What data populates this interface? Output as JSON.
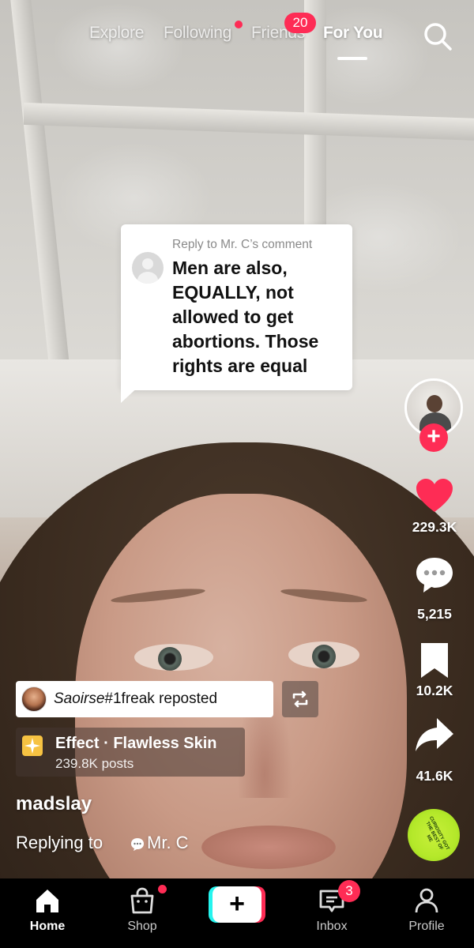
{
  "top_nav": {
    "tabs": [
      {
        "label": "Explore"
      },
      {
        "label": "Following"
      },
      {
        "label": "Friends"
      },
      {
        "label": "For You"
      }
    ],
    "friends_badge": "20",
    "active_tab": "For You"
  },
  "reply_sticker": {
    "reply_to": "Reply to Mr. C’s comment",
    "text": "Men are also, EQUALLY, not allowed to get abortions. Those rights are equal"
  },
  "rail": {
    "likes": "229.3K",
    "comments": "5,215",
    "saves": "10.2K",
    "shares": "41.6K",
    "follow_plus": "+",
    "music_disc_text": "CURIOSITY GOT THE BEST OF ME"
  },
  "overlay": {
    "repost_name": "Saoirse",
    "repost_rest": "#1freak reposted",
    "effect_title": "Effect · Flawless Skin",
    "effect_posts": "239.8K posts",
    "username": "madslay",
    "replying_prefix": "Replying to",
    "replying_user": "Mr. C"
  },
  "bottom_bar": {
    "tabs": [
      {
        "label": "Home",
        "icon": "home-icon"
      },
      {
        "label": "Shop",
        "icon": "shop-bag-icon"
      },
      {
        "label": "",
        "icon": "create-plus-icon"
      },
      {
        "label": "Inbox",
        "icon": "inbox-icon"
      },
      {
        "label": "Profile",
        "icon": "profile-icon"
      }
    ],
    "inbox_badge": "3",
    "create_symbol": "+"
  },
  "colors": {
    "accent": "#fe2c55",
    "create_cyan": "#25f4ee",
    "effect_icon": "#f6c242"
  }
}
